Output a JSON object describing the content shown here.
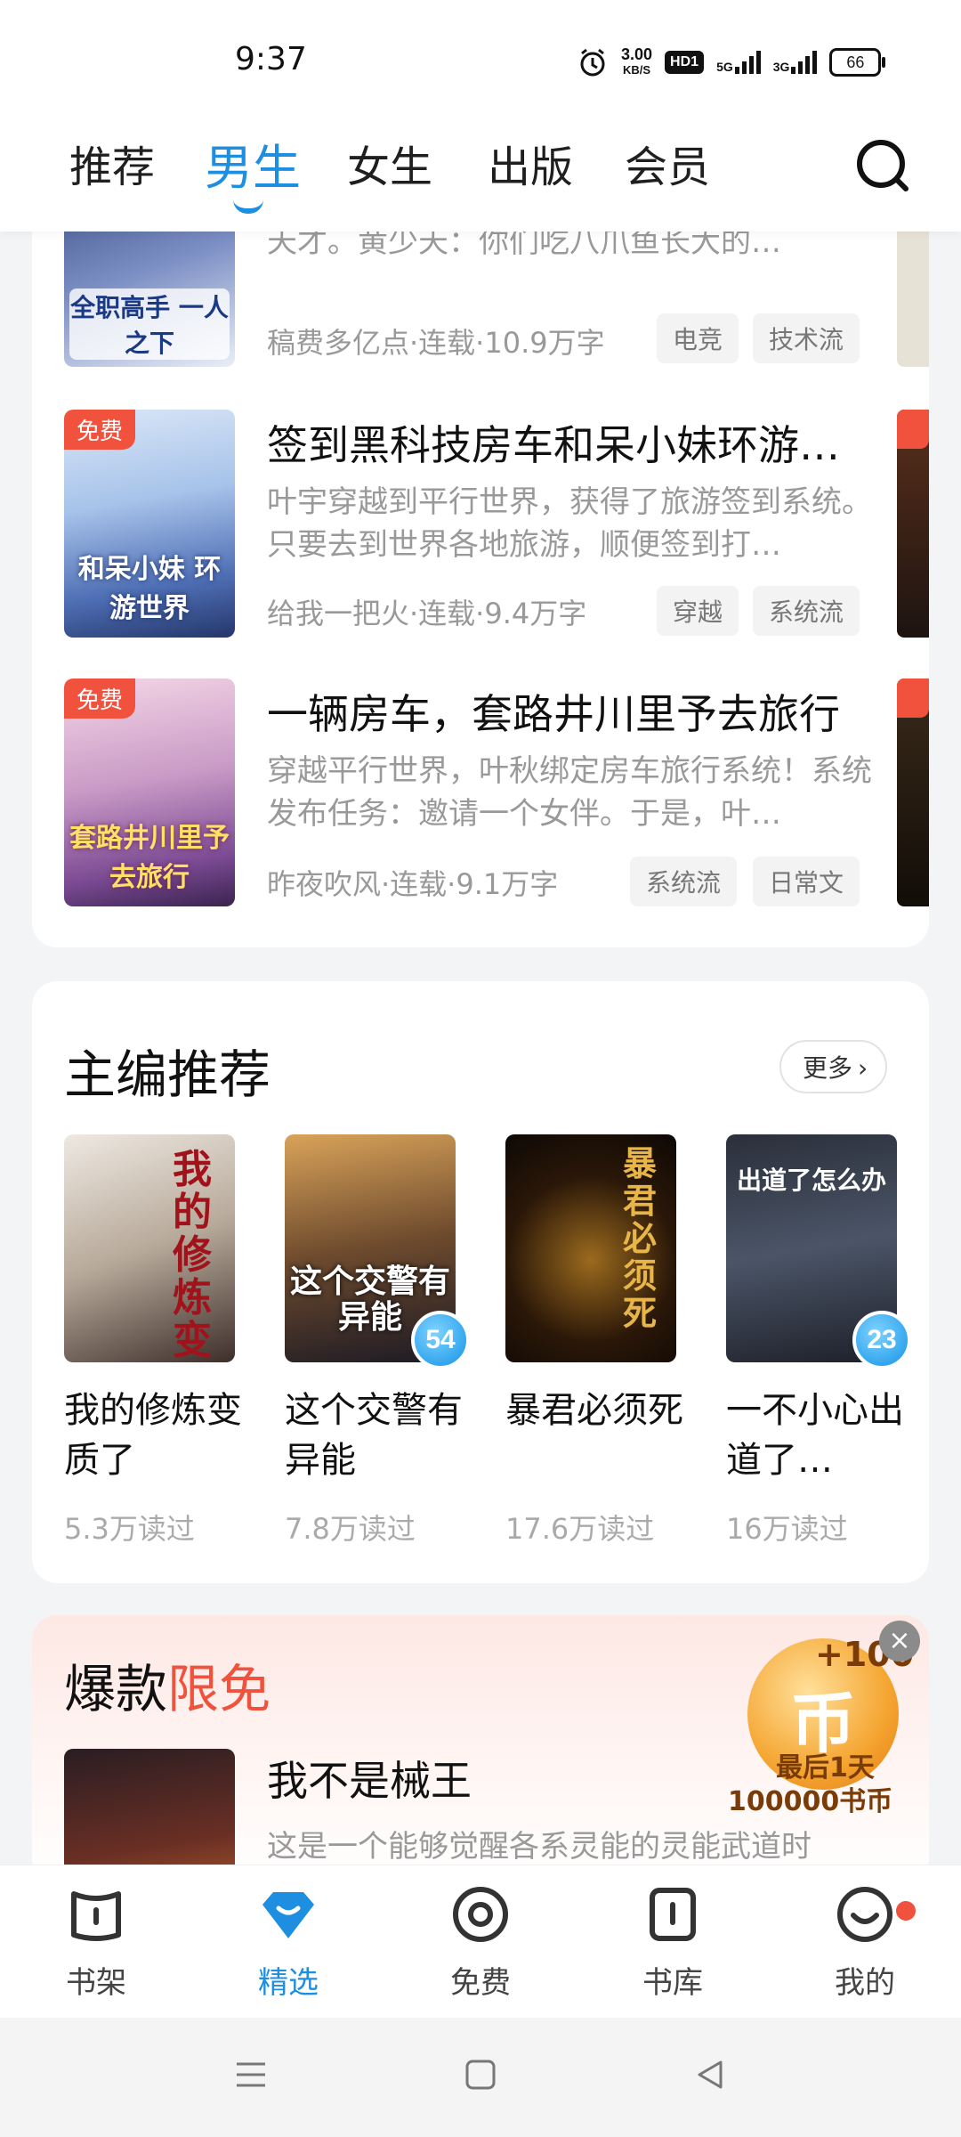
{
  "status_bar": {
    "time": "9:37",
    "speed_value": "3.00",
    "speed_unit": "KB/S",
    "hd": "HD1",
    "sig1": "5G",
    "sig2": "3G",
    "battery": "66"
  },
  "top_tabs": [
    "推荐",
    "男生",
    "女生",
    "出版",
    "会员"
  ],
  "active_tab": "男生",
  "book_list": [
    {
      "cover_text": "全职高手 一人之下",
      "desc": "叶修：我有一个朋友，他和你一样，也是一个天才。黄少天：你们吃八爪鱼长大的…",
      "meta": "稿费多亿点·连载·10.9万字",
      "tags": [
        "电竞",
        "技术流"
      ]
    },
    {
      "free": "免费",
      "cover_text": "和呆小妹 环游世界",
      "title": "签到黑科技房车和呆小妹环游…",
      "desc": "叶宇穿越到平行世界，获得了旅游签到系统。只要去到世界各地旅游，顺便签到打…",
      "meta": "给我一把火·连载·9.4万字",
      "tags": [
        "穿越",
        "系统流"
      ]
    },
    {
      "free": "免费",
      "cover_text": "套路井川里予 去旅行",
      "title": "一辆房车，套路井川里予去旅行",
      "desc": "穿越平行世界，叶秋绑定房车旅行系统！系统发布任务：邀请一个女伴。于是，叶…",
      "meta": "昨夜吹风·连载·9.1万字",
      "tags": [
        "系统流",
        "日常文"
      ]
    }
  ],
  "editor_picks": {
    "title": "主编推荐",
    "more": "更多",
    "books": [
      {
        "title": "我的修炼变质了",
        "reads": "5.3万读过",
        "cover_text": "我的修炼变质了"
      },
      {
        "title": "这个交警有异能",
        "reads": "7.8万读过",
        "cover_text": "这个交警有异能",
        "badge": "54"
      },
      {
        "title": "暴君必须死",
        "reads": "17.6万读过",
        "cover_text": "暴君必须死"
      },
      {
        "title": "一不小心出道了…",
        "reads": "16万读过",
        "cover_text": "出道了怎么办",
        "badge": "23"
      }
    ]
  },
  "hot_free": {
    "title_part1": "爆款",
    "title_part2": "限免",
    "book_title": "我不是械王",
    "book_desc": "这是一个能够觉醒各系灵能的灵能武道时",
    "promo": {
      "plus": "+100",
      "coin": "币",
      "line1": "最后1天",
      "line2": "100000书币"
    }
  },
  "bottom_nav": [
    {
      "label": "书架",
      "icon": "bookshelf-icon"
    },
    {
      "label": "精选",
      "icon": "featured-icon",
      "active": true
    },
    {
      "label": "免费",
      "icon": "free-icon"
    },
    {
      "label": "书库",
      "icon": "library-icon"
    },
    {
      "label": "我的",
      "icon": "profile-icon"
    }
  ],
  "colors": {
    "accent": "#1e8fe0",
    "free_badge": "#f0523e",
    "limited": "#f0523e"
  }
}
